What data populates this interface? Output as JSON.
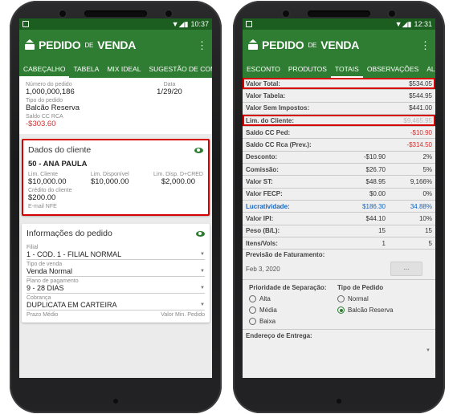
{
  "left": {
    "status_time": "10:37",
    "brand": {
      "pre": "PEDIDO",
      "mid": "DE",
      "post": "VENDA"
    },
    "tabs": [
      "CABEÇALHO",
      "TABELA",
      "MIX IDEAL",
      "SUGESTÃO DE COMPRA"
    ],
    "header": {
      "numero_label": "Número do pedido",
      "numero": "1,000,000,186",
      "data_label": "Data",
      "data": "1/29/20",
      "tipo_label": "Tipo do pedido",
      "tipo": "Balcão Reserva",
      "saldo_label": "Saldo CC RCA",
      "saldo": "-$303.60"
    },
    "cliente": {
      "title": "Dados do cliente",
      "nome": "50 - ANA PAULA",
      "lim_label": "Lim. Cliente",
      "lim": "$10,000.00",
      "disp_label": "Lim. Disponível",
      "disp": "$10,000.00",
      "dcred_label": "Lim. Disp. D+CRED",
      "dcred": "$2,000.00",
      "credito_label": "Crédito do cliente",
      "credito": "$200.00",
      "email_label": "E-mail NFE"
    },
    "info": {
      "title": "Informações do pedido",
      "filial_label": "Filial",
      "filial": "1 - COD. 1 - FILIAL NORMAL",
      "tipovenda_label": "Tipo de venda",
      "tipovenda": "Venda Normal",
      "plano_label": "Plano de pagamento",
      "plano": "9 - 28 DIAS",
      "cobranca_label": "Cobrança",
      "cobranca": "DUPLICATA EM CARTEIRA",
      "prazo_label": "Prazo Médio",
      "valormin_label": "Valor Min. Pedido"
    }
  },
  "right": {
    "status_time": "12:31",
    "tabs": [
      "ESCONTO",
      "PRODUTOS",
      "TOTAIS",
      "OBSERVAÇÕES",
      "ALERTA"
    ],
    "rows": [
      {
        "k": "Valor Total:",
        "c2": "",
        "c3": "$534.05"
      },
      {
        "k": "Valor Tabela:",
        "c2": "",
        "c3": "$544.95"
      },
      {
        "k": "Valor Sem Impostos:",
        "c2": "",
        "c3": "$441.00"
      },
      {
        "k": "Lim. do Cliente:",
        "c2": "",
        "c3": "$9,465.95"
      },
      {
        "k": "Saldo CC Ped:",
        "c2": "",
        "c3": "-$10.90"
      },
      {
        "k": "Saldo CC Rca (Prev.):",
        "c2": "",
        "c3": "-$314.50"
      },
      {
        "k": "Desconto:",
        "c2": "-$10.90",
        "c3": "2%"
      },
      {
        "k": "Comissão:",
        "c2": "$26.70",
        "c3": "5%"
      },
      {
        "k": "Valor ST:",
        "c2": "$48.95",
        "c3": "9,166%"
      },
      {
        "k": "Valor FECP:",
        "c2": "$0.00",
        "c3": "0%"
      },
      {
        "k": "Lucratividade:",
        "c2": "$186.30",
        "c3": "34.88%"
      },
      {
        "k": "Valor IPI:",
        "c2": "$44.10",
        "c3": "10%"
      },
      {
        "k": "Peso (B/L):",
        "c2": "15",
        "c3": "15"
      },
      {
        "k": "Itens/Vols:",
        "c2": "1",
        "c3": "5"
      }
    ],
    "previsao_label": "Previsão de Faturamento:",
    "previsao_date": "Feb 3, 2020",
    "dots": "...",
    "prioridade_label": "Prioridade de Separação:",
    "prioridades": [
      "Alta",
      "Média",
      "Baixa"
    ],
    "tipopedido_label": "Tipo de Pedido",
    "tipos": [
      "Normal",
      "Balcão Reserva"
    ],
    "endereco_label": "Endereço de Entrega:"
  }
}
